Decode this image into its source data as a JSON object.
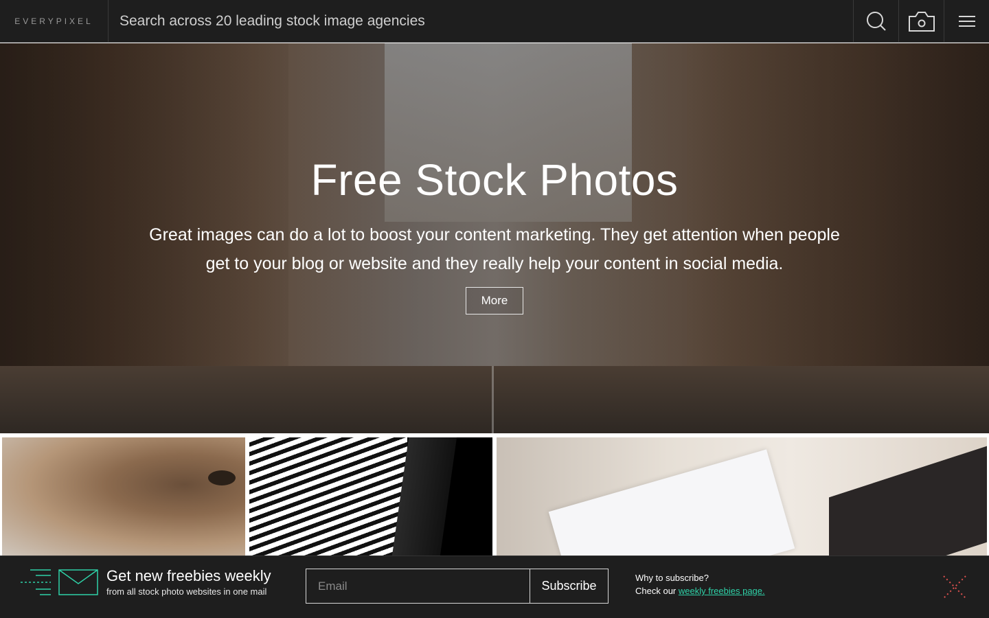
{
  "header": {
    "logo_text": "EVERYPIXEL",
    "search_placeholder": "Search across 20 leading stock image agencies",
    "icons": [
      "search-icon",
      "camera-icon",
      "menu-icon"
    ]
  },
  "hero": {
    "title": "Free Stock Photos",
    "description": "Great images can do a lot to boost your content marketing. They get attention when people get to your blog or website and they really help your content in social media.",
    "more_label": "More"
  },
  "thumbnails": [
    "bear-closeup",
    "striped-building",
    "paper-on-desk"
  ],
  "newsletter": {
    "title": "Get new freebies weekly",
    "subtitle": "from all stock photo websites in one mail",
    "email_placeholder": "Email",
    "subscribe_label": "Subscribe",
    "why_text": "Why to subscribe?",
    "check_prefix": "Check our ",
    "check_link": "weekly freebies page."
  },
  "colors": {
    "topbar_bg": "#1e1e1e",
    "accent_green": "#2fd2a8",
    "close_red": "#e0524f"
  }
}
